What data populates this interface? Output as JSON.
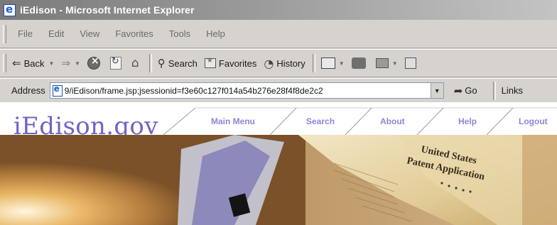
{
  "window": {
    "title": "iEdison - Microsoft Internet Explorer",
    "icon": "ie-icon"
  },
  "menubar": {
    "items": [
      "File",
      "Edit",
      "View",
      "Favorites",
      "Tools",
      "Help"
    ]
  },
  "toolbar": {
    "back_label": "Back",
    "search_label": "Search",
    "favorites_label": "Favorites",
    "history_label": "History"
  },
  "addressbar": {
    "label": "Address",
    "url": "9/iEdison/frame.jsp;jsessionid=f3e60c127f014a54b276e28f4f8de2c2",
    "go_label": "Go",
    "links_label": "Links"
  },
  "site": {
    "logo": "iEdison.gov",
    "nav": [
      "Main Menu",
      "Search",
      "About",
      "Help",
      "Logout"
    ],
    "banner_text_line1": "United States",
    "banner_text_line2": "Patent Application",
    "colors": {
      "logo": "#6f63c7",
      "nav": "#8e85d6"
    }
  }
}
